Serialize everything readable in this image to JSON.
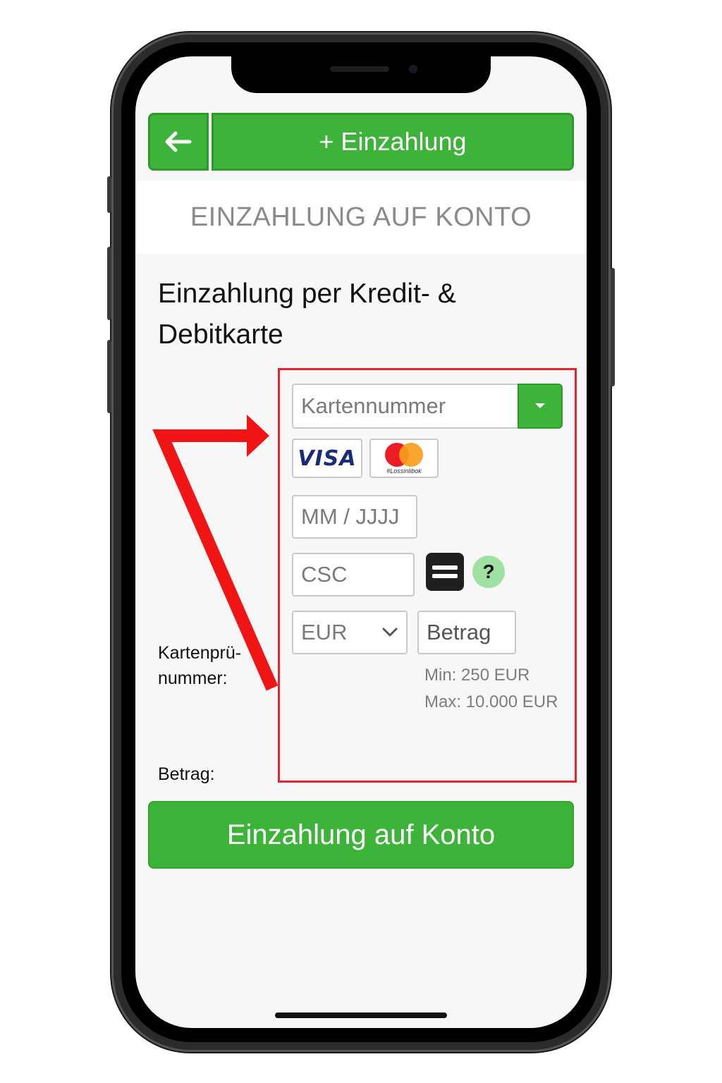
{
  "topbar": {
    "back_icon": "arrow-left-icon",
    "deposit_tab_label": "+ Einzahlung"
  },
  "header": {
    "title": "EINZAHLUNG AUF KONTO"
  },
  "section": {
    "title": "Einzahlung per Kredit- & Debitkarte"
  },
  "labels": {
    "card_number_line1": "Kartenprü-",
    "card_number_line2": "nummer:",
    "amount": "Betrag:"
  },
  "form": {
    "card_number_placeholder": "Kartennummer",
    "expiry_placeholder": "MM / JJJJ",
    "csc_placeholder": "CSC",
    "currency_value": "EUR",
    "amount_placeholder": "Betrag",
    "min_hint": "Min: 250 EUR",
    "max_hint": "Max: 10.000 EUR"
  },
  "card_logos": {
    "visa": "VISA",
    "mastercard_caption": "#Lossinlibok"
  },
  "submit": {
    "label": "Einzahlung auf Konto"
  },
  "colors": {
    "brand_green": "#3db33a",
    "annotation_red": "#e3262c",
    "help_green": "#9fe0a3"
  }
}
